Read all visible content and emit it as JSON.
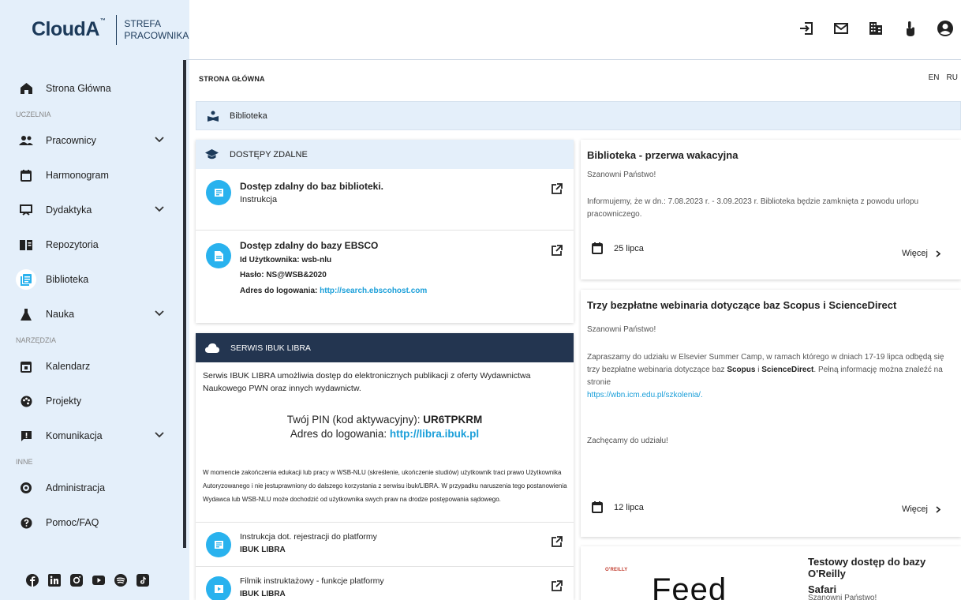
{
  "brand": {
    "name": "CloudA",
    "tm": "™",
    "sub_line1": "STREFA",
    "sub_line2": "PRACOWNIKA"
  },
  "sidebar": {
    "home": "Strona Główna",
    "section_uczelnia": "UCZELNIA",
    "pracownicy": "Pracownicy",
    "harmonogram": "Harmonogram",
    "dydaktyka": "Dydaktyka",
    "repozytoria": "Repozytoria",
    "biblioteka": "Biblioteka",
    "nauka": "Nauka",
    "section_narzedzia": "NARZĘDZIA",
    "kalendarz": "Kalendarz",
    "projekty": "Projekty",
    "komunikacja": "Komunikacja",
    "section_inne": "INNE",
    "administracja": "Administracja",
    "pomoc": "Pomoc/FAQ"
  },
  "breadcrumb": "STRONA GŁÓWNA",
  "lang": {
    "en": "EN",
    "ru": "RU"
  },
  "section_title": "Biblioteka",
  "remote": {
    "header": "DOSTĘPY ZDALNE",
    "item1": {
      "title": "Dostęp zdalny do baz biblioteki.",
      "sub": "Instrukcja"
    },
    "item2": {
      "title": "Dostęp zdalny do bazy EBSCO",
      "user_line": "Id Użytkownika: wsb-nlu",
      "pass_line": "Hasło: NS@WSB&2020",
      "login_label": "Adres do logowania: ",
      "login_url": "http://search.ebscohost.com"
    }
  },
  "ibuk": {
    "header": "SERWIS IBUK LIBRA",
    "desc": "Serwis IBUK LIBRA umożliwia dostęp do elektronicznych publikacji z oferty Wydawnictwa Naukowego PWN oraz innych wydawnictw.",
    "pin_label": "Twój PIN (kod aktywacyjny): ",
    "pin_value": "UR6TPKRM",
    "login_label": "Adres do logowania: ",
    "login_url": "http://libra.ibuk.pl",
    "note": "W momencie zakończenia edukacji lub pracy w WSB-NLU (skreślenie, ukończenie studiów) użytkownik traci prawo Użytkownika Autoryzowanego i nie jestuprawniony do dalszego korzystania z serwisu ibuk/LIBRA. W przypadku naruszenia tego postanowienia Wydawca lub WSB-NLU może dochodzić od użytkownika swych praw na drodze postępowania sądowego.",
    "row1": {
      "title": "Instrukcja dot. rejestracji do platformy",
      "sub": "IBUK LIBRA"
    },
    "row2": {
      "title": "Filmik instruktażowy - funkcje platformy",
      "sub": "IBUK LIBRA"
    }
  },
  "news": [
    {
      "title": "Biblioteka - przerwa wakacyjna",
      "greeting": "Szanowni Państwo!",
      "body": "Informujemy, że w dn.: 7.08.2023 r. - 3.09.2023 r. Biblioteka będzie zamknięta z powodu urlopu pracowniczego.",
      "date": "25 lipca",
      "more": "Więcej"
    },
    {
      "title": "Trzy bezpłatne webinaria dotyczące baz Scopus i ScienceDirect",
      "greeting": "Szanowni Państwo!",
      "body_pre": "Zapraszamy do udziału w Elsevier Summer Camp, w ramach którego w dniach 17-19 lipca odbędą się trzy bezpłatne webinaria dotyczące baz ",
      "body_b1": "Scopus",
      "body_mid": " i ",
      "body_b2": "ScienceDirect",
      "body_post": ". Pełną informację można znaleźć na stronie",
      "link": "https://wbn.icm.edu.pl/szkolenia/.",
      "closing": "Zachęcamy do udziału!",
      "date": "12 lipca",
      "more": "Więcej"
    },
    {
      "title_line1": "Testowy dostęp do bazy O'Reilly",
      "title_line2": "Safari",
      "greeting": "Szanowni Państwo!",
      "logo_text": "O'REILLY",
      "image_text": "Feed"
    }
  ],
  "colors": {
    "accent": "#29b2ee",
    "dark_header": "#233550",
    "sidebar_bg": "#e4effa",
    "link": "#1b9fd9"
  }
}
